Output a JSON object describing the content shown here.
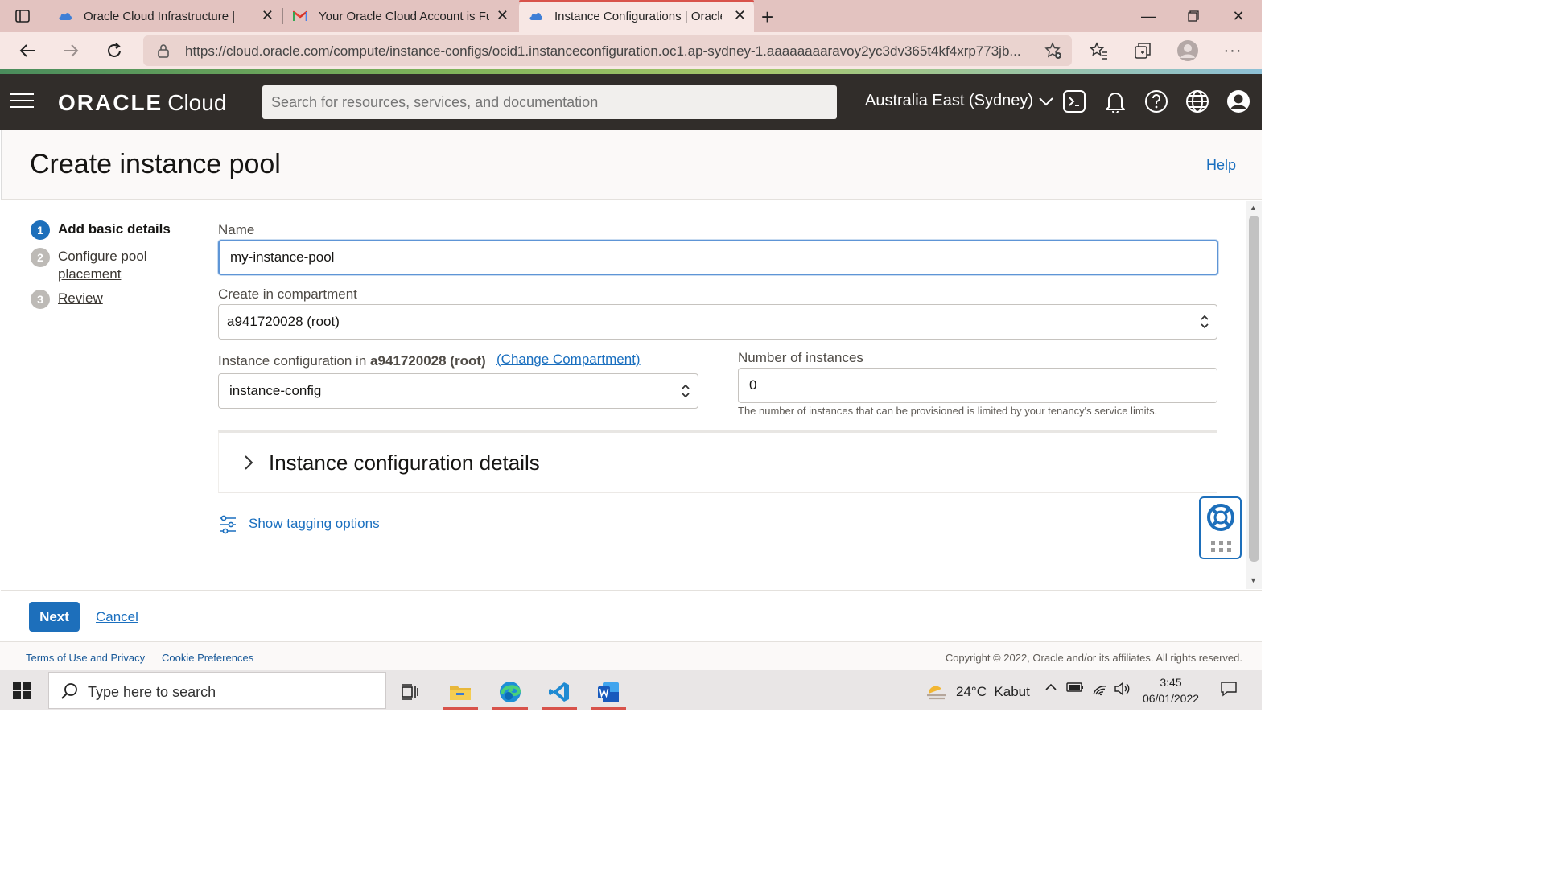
{
  "browser": {
    "tabs": [
      {
        "label": "Oracle Cloud Infrastructure | Sign In",
        "icon": "cloud-icon"
      },
      {
        "label": "Your Oracle Cloud Account is Fully Provisioned",
        "icon": "gmail-icon"
      },
      {
        "label": "Instance Configurations | Oracle Cloud",
        "icon": "cloud-icon",
        "active": true
      }
    ],
    "url": "https://cloud.oracle.com/compute/instance-configs/ocid1.instanceconfiguration.oc1.ap-sydney-1.aaaaaaaaravoy2yc3dv365t4kf4xrp773jb..."
  },
  "header": {
    "brand": "ORACLE",
    "product": "Cloud",
    "search_placeholder": "Search for resources, services, and documentation",
    "region": "Australia East (Sydney)"
  },
  "page": {
    "title": "Create instance pool",
    "help": "Help"
  },
  "steps": [
    {
      "number": "1",
      "label": "Add basic details",
      "active": true
    },
    {
      "number": "2",
      "label": "Configure pool placement"
    },
    {
      "number": "3",
      "label": "Review"
    }
  ],
  "form": {
    "name_label": "Name",
    "name_value": "my-instance-pool",
    "compartment_label": "Create in compartment",
    "compartment_value": "a941720028 (root)",
    "instance_config_label_prefix": "Instance configuration in",
    "instance_config_compartment": "a941720028 (root)",
    "change_compartment": "(Change Compartment)",
    "instance_config_value": "instance-config",
    "num_instances_label": "Number of instances",
    "num_instances_value": "0",
    "num_instances_hint": "The number of instances that can be provisioned is limited by your tenancy's service limits.",
    "details_section": "Instance configuration details",
    "tagging_link": "Show tagging options"
  },
  "actions": {
    "next": "Next",
    "cancel": "Cancel"
  },
  "footer": {
    "terms": "Terms of Use and Privacy",
    "cookies": "Cookie Preferences",
    "copyright": "Copyright © 2022, Oracle and/or its affiliates. All rights reserved."
  },
  "taskbar": {
    "search_placeholder": "Type here to search",
    "weather": "24°C  Kabut",
    "time": "3:45",
    "date": "06/01/2022"
  },
  "colors": {
    "oci_header": "#312d2a",
    "primary": "#1d6fbb",
    "link": "#1a6fbf",
    "tabbar": "#e3c3c0"
  }
}
